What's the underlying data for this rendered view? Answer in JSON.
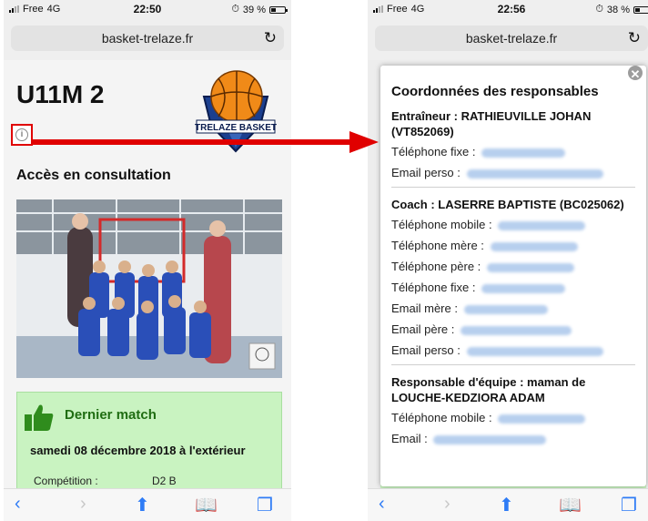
{
  "left": {
    "status": {
      "carrier": "Free",
      "network": "4G",
      "time": "22:50",
      "battery": "39 %",
      "battery_level": 0.39
    },
    "url": "basket-trelaze.fr",
    "team_title": "U11M 2",
    "logo_text": "TRELAZE BASKET",
    "access_text": "Accès en consultation",
    "match": {
      "heading": "Dernier match",
      "date": "samedi 08 décembre 2018 à l'extérieur",
      "competition_label": "Compétition :",
      "competition_value": "D2 B"
    }
  },
  "right": {
    "status": {
      "carrier": "Free",
      "network": "4G",
      "time": "22:56",
      "battery": "38 %",
      "battery_level": 0.38
    },
    "url": "basket-trelaze.fr",
    "modal": {
      "close": "✕",
      "title": "Coordonnées des responsables",
      "trainer": {
        "role": "Entraîneur : RATHIEUVILLE JOHAN (VT852069)",
        "phone_fixed_label": "Téléphone fixe :",
        "email_perso_label": "Email perso :"
      },
      "coach": {
        "role": "Coach : LASERRE BAPTISTE (BC025062)",
        "phone_mobile_label": "Téléphone mobile :",
        "phone_mother_label": "Téléphone mère :",
        "phone_father_label": "Téléphone père :",
        "phone_fixed_label": "Téléphone fixe :",
        "email_mother_label": "Email mère :",
        "email_father_label": "Email père :",
        "email_perso_label": "Email perso :"
      },
      "manager": {
        "role": "Responsable d'équipe : maman de LOUCHE-KEDZIORA ADAM",
        "phone_mobile_label": "Téléphone mobile :",
        "email_label": "Email :"
      }
    }
  },
  "colors": {
    "accent": "#2f7cf6",
    "highlight_red": "#e00000",
    "match_green": "#c9f3c1",
    "match_heading": "#1f6d12"
  },
  "icons": [
    "reload-icon",
    "back-icon",
    "forward-icon",
    "share-icon",
    "bookmarks-icon",
    "tabs-icon",
    "info-icon",
    "thumbs-up-icon",
    "close-icon"
  ]
}
